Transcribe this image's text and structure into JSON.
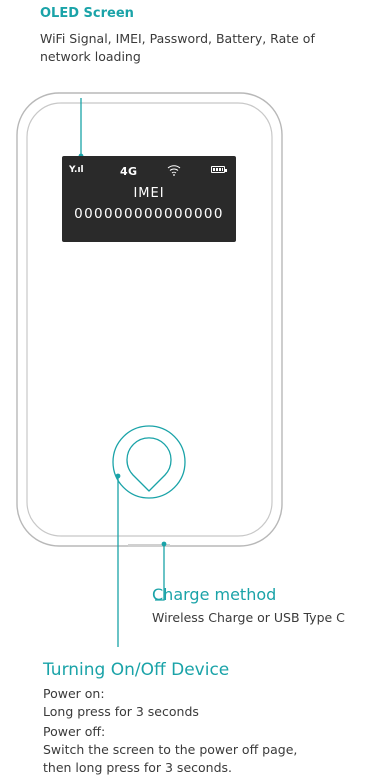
{
  "oled": {
    "title": "OLED Screen",
    "desc": "WiFi Signal, IMEI, Password, Battery, Rate of network loading"
  },
  "screen": {
    "signal": "Y.ıl",
    "network": "4G",
    "imei_label": "IMEI",
    "imei_value": "000000000000000"
  },
  "charge": {
    "title": "Charge method",
    "desc": "Wireless Charge or USB Type C"
  },
  "power": {
    "title": "Turning On/Off Device",
    "on_label": "Power on:",
    "on_desc": "Long press for 3 seconds",
    "off_label": "Power off:",
    "off_desc1": "Switch the screen to the power off page,",
    "off_desc2": "then long press for 3 seconds."
  },
  "colors": {
    "accent": "#1aa3a8",
    "screen": "#2a2a2a",
    "outline": "#bdbdbd"
  },
  "icons": [
    "signal-icon",
    "wifi-icon",
    "battery-icon",
    "power-button-icon"
  ]
}
